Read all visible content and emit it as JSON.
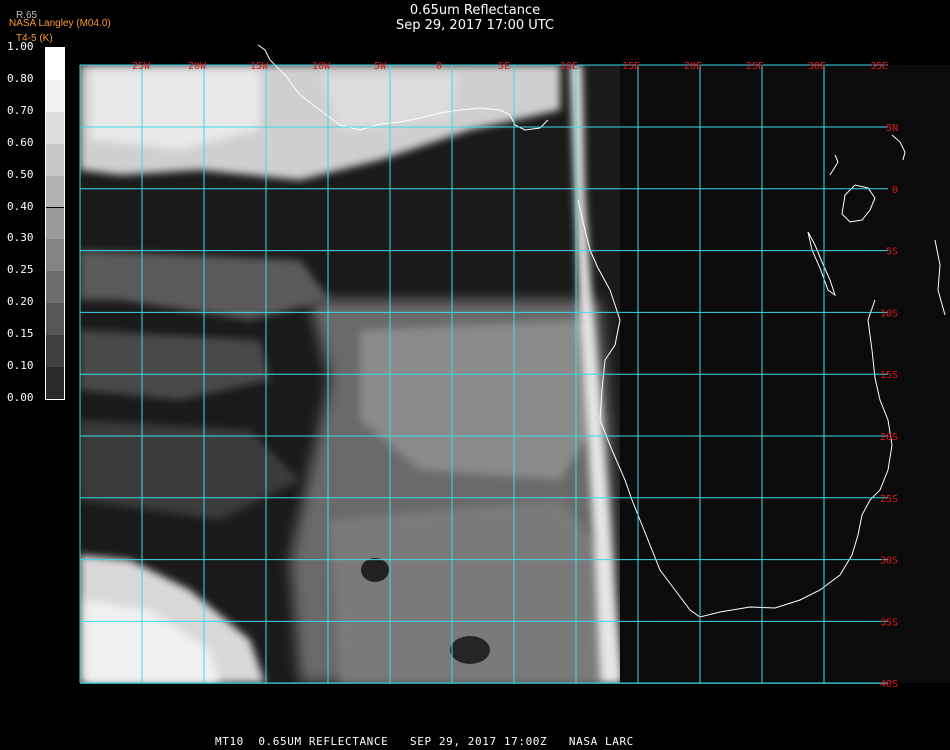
{
  "header": {
    "title": "0.65um Reflectance",
    "subtitle": "Sep 29, 2017 17:00 UTC",
    "producer": "NASA Langley (M04.0)",
    "product_code": "T4-5 (K)",
    "unit": "R.65"
  },
  "colorbar": {
    "ticks": [
      "1.00",
      "0.80",
      "0.70",
      "0.60",
      "0.50",
      "0.40",
      "0.30",
      "0.25",
      "0.20",
      "0.15",
      "0.10",
      "0.00"
    ]
  },
  "map": {
    "lon_labels": [
      "25W",
      "20W",
      "15W",
      "10W",
      "5W",
      "0",
      "5E",
      "10E",
      "15E",
      "20E",
      "25E",
      "30E",
      "35E"
    ],
    "lat_labels": [
      "5N",
      "0",
      "5S",
      "10S",
      "15S",
      "20S",
      "25S",
      "30S",
      "35S",
      "40S"
    ],
    "grid_color": "#40d8e8",
    "label_color": "#e01818",
    "coast_color": "#ffffff"
  },
  "footer": {
    "text": "MT10  0.65UM REFLECTANCE   SEP 29, 2017 17:00Z   NASA LARC"
  }
}
